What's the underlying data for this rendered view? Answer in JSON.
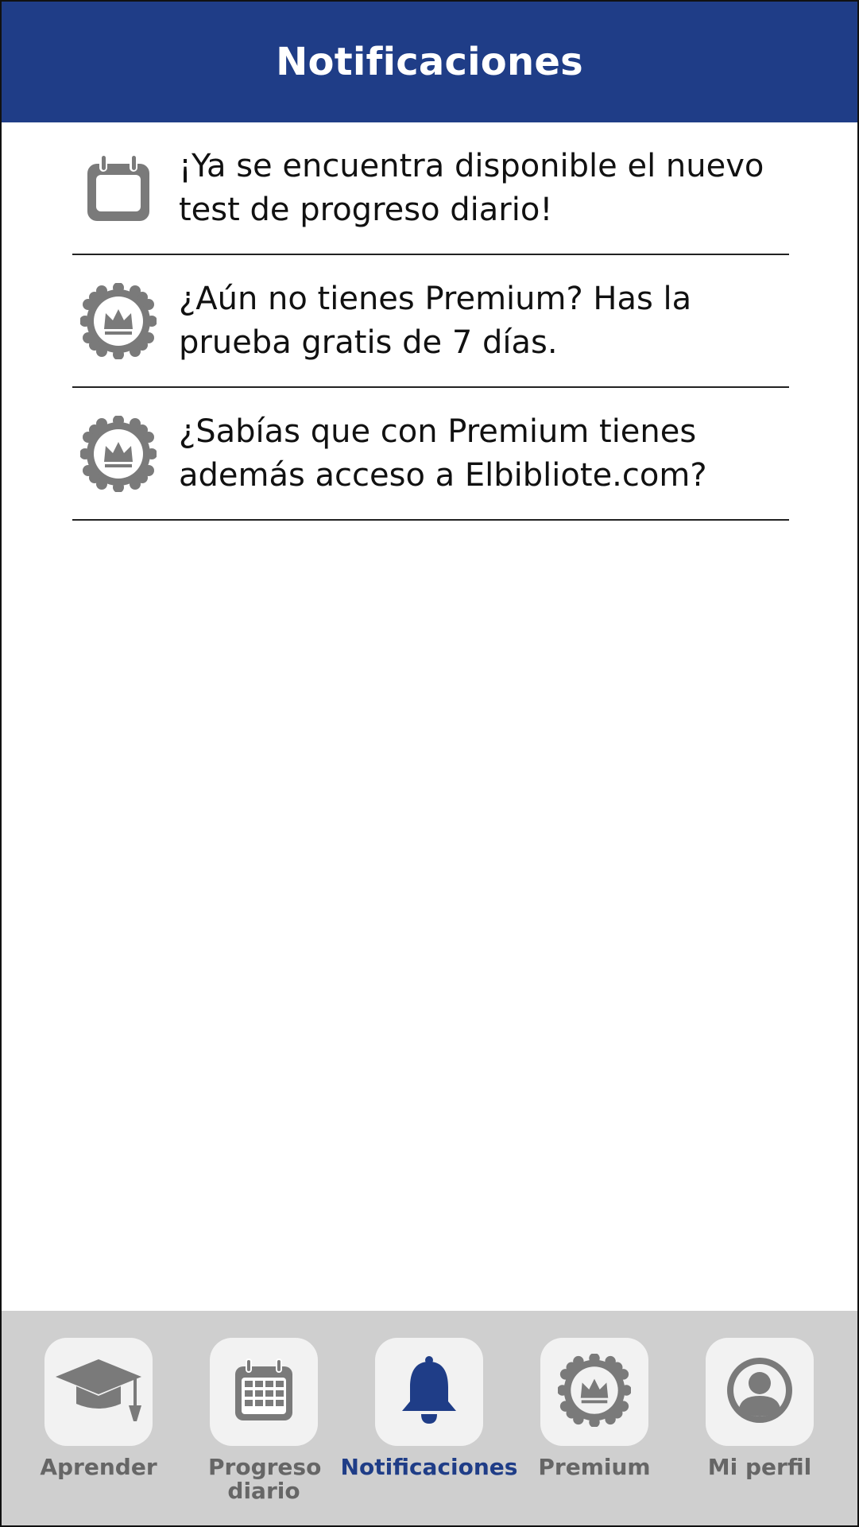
{
  "header": {
    "title": "Notificaciones",
    "background": "#1f3d87"
  },
  "notifications": [
    {
      "icon": "calendar-icon",
      "text": "¡Ya se encuentra disponible el nuevo test de progreso diario!"
    },
    {
      "icon": "premium-badge-icon",
      "text": "¿Aún no tienes Premium? Has la prueba gratis de 7 días."
    },
    {
      "icon": "premium-badge-icon",
      "text": "¿Sabías que con Premium tienes además acceso a Elbibliote.com?"
    }
  ],
  "tabbar": {
    "tabs": [
      {
        "label": "Aprender",
        "icon": "graduation-cap-icon",
        "active": false
      },
      {
        "label": "Progreso diario",
        "icon": "calendar-grid-icon",
        "active": false
      },
      {
        "label": "Notificaciones",
        "icon": "bell-icon",
        "active": true
      },
      {
        "label": "Premium",
        "icon": "premium-badge-icon",
        "active": false
      },
      {
        "label": "Mi perfil",
        "icon": "user-profile-icon",
        "active": false
      }
    ]
  },
  "colors": {
    "accent": "#1f3d87",
    "icon_gray": "#7a7a7a",
    "tabbar_bg": "#cfcfcf"
  }
}
